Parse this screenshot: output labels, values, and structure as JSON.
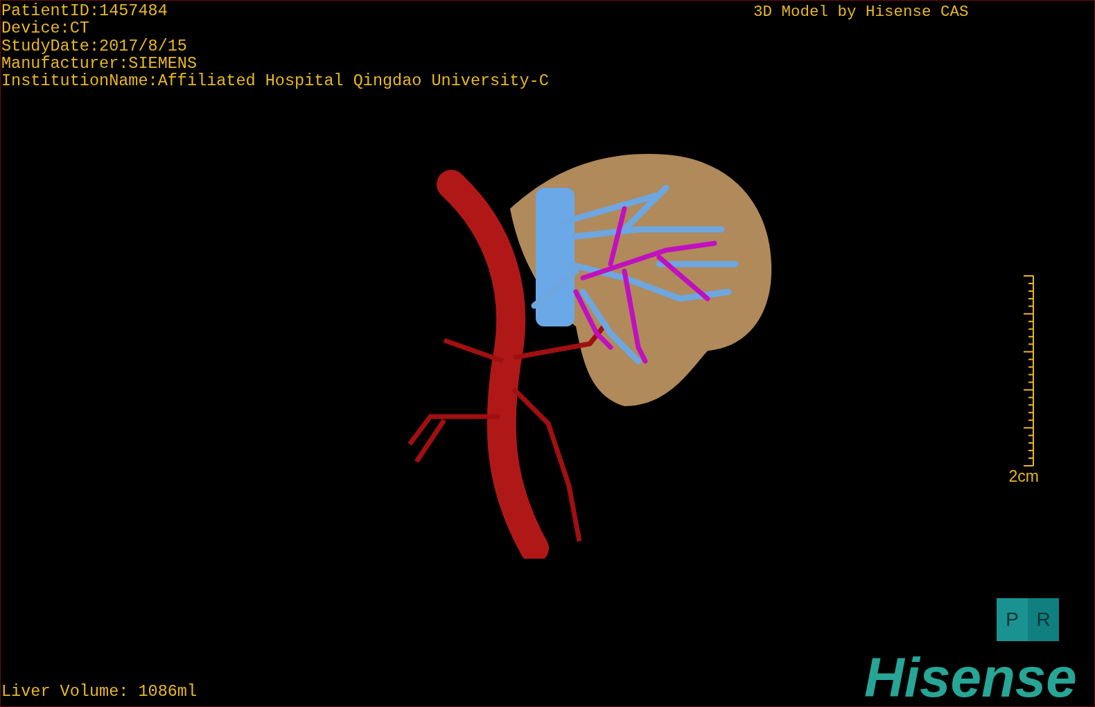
{
  "patient_info": [
    "PatientID:1457484",
    "Device:CT",
    "StudyDate:2017/8/15",
    "Manufacturer:SIEMENS",
    "InstitutionName:Affiliated Hospital Qingdao University-C"
  ],
  "model_caption": "3D Model by Hisense CAS",
  "scale_bar": {
    "label": "2cm"
  },
  "orientation_cube": {
    "faces": [
      "P",
      "R"
    ]
  },
  "liver_volume": "Liver Volume: 1086ml",
  "logo": "Hisense"
}
